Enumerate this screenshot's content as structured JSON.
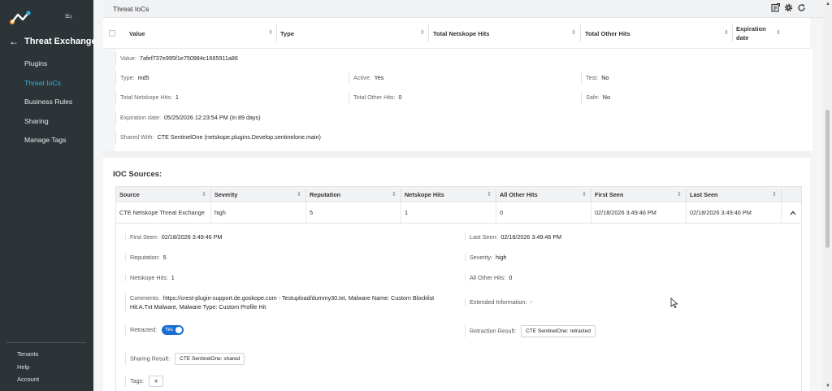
{
  "sidebar": {
    "module_title": "Threat Exchange",
    "nav": [
      {
        "label": "Plugins",
        "active": false
      },
      {
        "label": "Threat IoCs",
        "active": true
      },
      {
        "label": "Business Rules",
        "active": false
      },
      {
        "label": "Sharing",
        "active": false
      },
      {
        "label": "Manage Tags",
        "active": false
      }
    ],
    "bottom": [
      "Tenants",
      "Help",
      "Account"
    ],
    "accent": "#2fb3e0"
  },
  "topbar": {
    "title": "Threat IoCs",
    "icons": [
      "export-icon",
      "gear-icon",
      "refresh-icon"
    ]
  },
  "ioc_table": {
    "columns": [
      "Value",
      "Type",
      "Total Netskope Hits",
      "Total Other Hits",
      "Expiration date"
    ]
  },
  "ioc_detail": {
    "value_label": "Value:",
    "value": "7afef737e995f1e750984c1665911a86",
    "type_label": "Type:",
    "type": "md5",
    "active_label": "Active:",
    "active": "Yes",
    "test_label": "Test:",
    "test": "No",
    "total_netskope_label": "Total Netskope Hits:",
    "total_netskope": "1",
    "total_other_label": "Total Other Hits:",
    "total_other": "0",
    "safe_label": "Safe:",
    "safe": "No",
    "expiration_label": "Expiration date:",
    "expiration": "05/25/2026 12:23:54 PM (In 89 days)",
    "shared_label": "Shared With:",
    "shared": "CTE SentinelOne (netskope.plugins.Develop.sentinelone.main)"
  },
  "sources": {
    "title": "IOC Sources:",
    "columns": [
      "Source",
      "Severity",
      "Reputation",
      "Netskope Hits",
      "All Other Hits",
      "First Seen",
      "Last Seen"
    ],
    "row": [
      "CTE Netskope Threat Exchange",
      "high",
      "5",
      "1",
      "0",
      "02/18/2026 3:49:46 PM",
      "02/18/2026 3:49:46 PM"
    ],
    "detail": {
      "first_seen_label": "First Seen:",
      "first_seen": "02/18/2026 3:49:46 PM",
      "last_seen_label": "Last Seen:",
      "last_seen": "02/18/2026 3:49:46 PM",
      "reputation_label": "Reputation:",
      "reputation": "5",
      "severity_label": "Severity:",
      "severity": "high",
      "netskope_hits_label": "Netskope Hits:",
      "netskope_hits": "1",
      "other_hits_label": "All Other Hits:",
      "other_hits": "0",
      "comments_label": "Comments:",
      "comments": "https://crest-plugin-support.de.goskope.com - Testupload/dummy30.txt, Malware Name: Custom Blocklist Hit:A.Txt Malware, Malware Type: Custom Profile Hit",
      "extended_label": "Extended Information:",
      "extended": "-",
      "retracted_label": "Retracted:",
      "retracted_toggle": "Yes",
      "retraction_result_label": "Retraction Result:",
      "retraction_result": "CTE SentinelOne: retracted",
      "sharing_result_label": "Sharing Result:",
      "sharing_result": "CTE SentinelOne: shared",
      "tags_label": "Tags:",
      "tags_add": "+"
    }
  }
}
